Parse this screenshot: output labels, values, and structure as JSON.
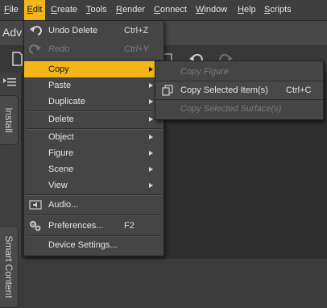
{
  "menubar": [
    {
      "id": "file",
      "first": "F",
      "rest": "ile"
    },
    {
      "id": "edit",
      "first": "E",
      "rest": "dit"
    },
    {
      "id": "create",
      "first": "C",
      "rest": "reate"
    },
    {
      "id": "tools",
      "first": "T",
      "rest": "ools"
    },
    {
      "id": "render",
      "first": "R",
      "rest": "ender"
    },
    {
      "id": "connect",
      "first": "C",
      "rest": "onnect"
    },
    {
      "id": "window",
      "first": "W",
      "rest": "indow"
    },
    {
      "id": "help",
      "first": "H",
      "rest": "elp"
    },
    {
      "id": "scripts",
      "first": "S",
      "rest": "cripts"
    }
  ],
  "background": {
    "tab_label": "Adv",
    "side_tabs": [
      "Install",
      "Smart Content"
    ]
  },
  "edit_menu": {
    "undo": {
      "label": "Undo Delete",
      "shortcut": "Ctrl+Z"
    },
    "redo": {
      "label": "Redo",
      "shortcut": "Ctrl+Y"
    },
    "copy": "Copy",
    "paste": "Paste",
    "duplicate": "Duplicate",
    "delete": "Delete",
    "object": "Object",
    "figure": "Figure",
    "scene": "Scene",
    "view": "View",
    "audio": "Audio...",
    "preferences": {
      "label": "Preferences...",
      "shortcut": "F2"
    },
    "device_settings": "Device Settings..."
  },
  "copy_submenu": {
    "copy_figure": "Copy Figure",
    "copy_selected_items": {
      "label": "Copy Selected Item(s)",
      "shortcut": "Ctrl+C"
    },
    "copy_selected_surfaces": "Copy Selected Surface(s)"
  },
  "colors": {
    "highlight": "#f2b51c",
    "menu_bg": "#454545",
    "disabled_text": "#7d7d7d"
  }
}
